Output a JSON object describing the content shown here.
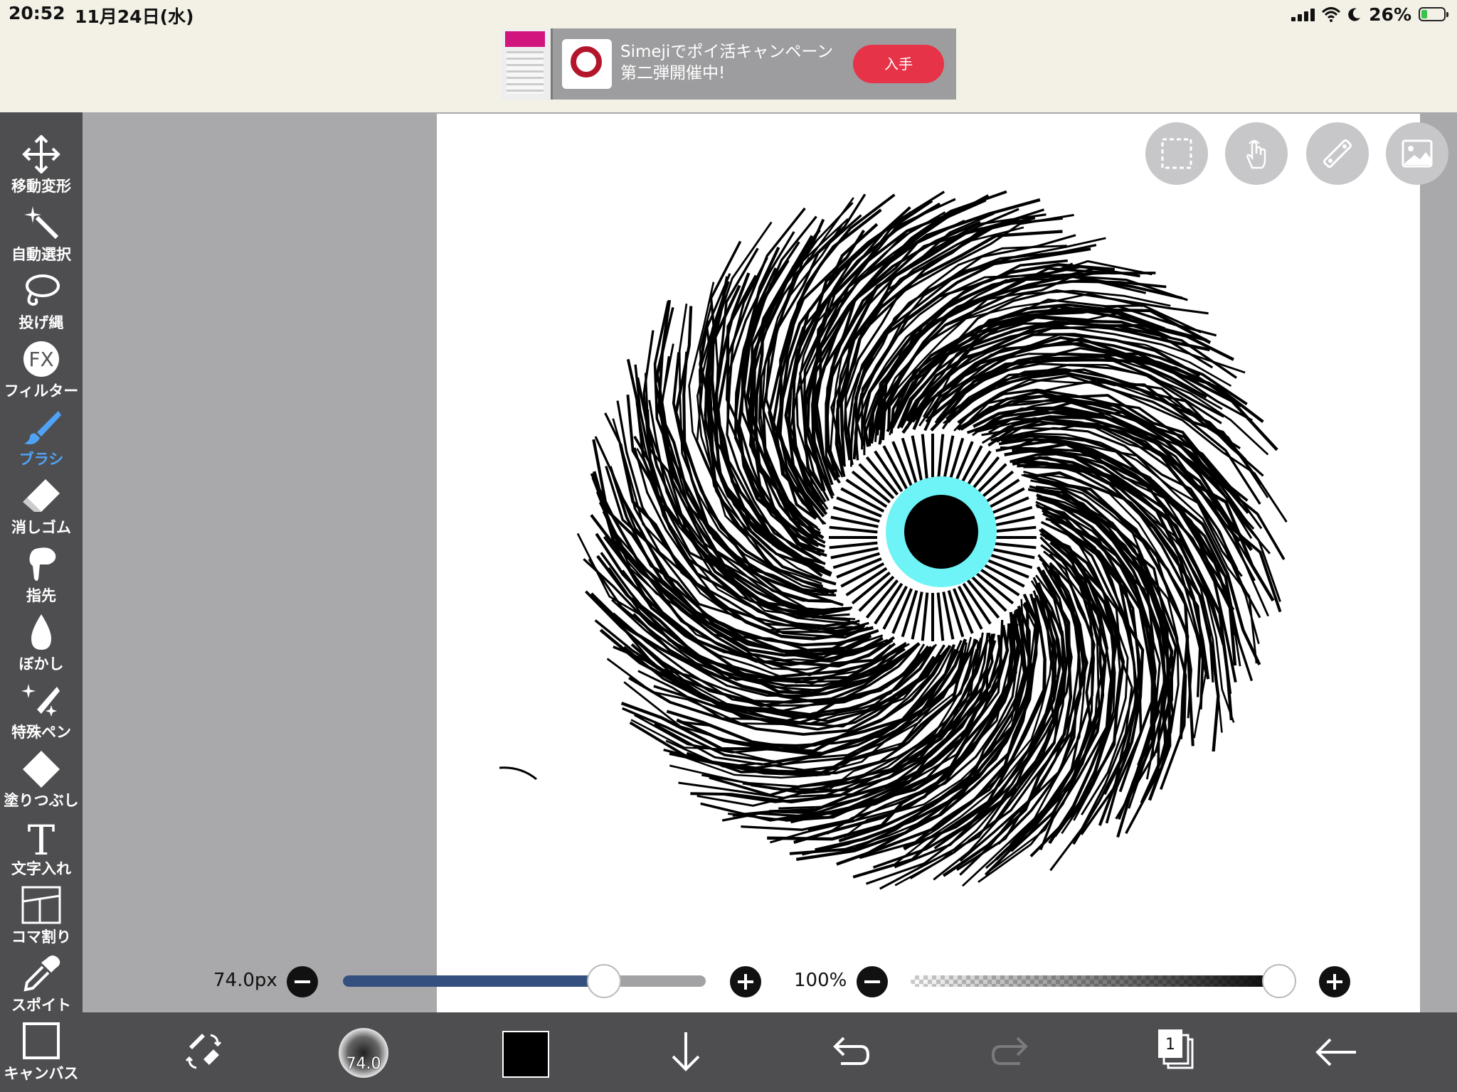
{
  "status_bar": {
    "time": "20:52",
    "date": "11月24日(水)",
    "battery_percent": "26%",
    "battery_level": 0.26
  },
  "ad": {
    "text": "Simejiでポイ活キャンペーン第二弾開催中!",
    "button_label": "入手"
  },
  "tools": [
    {
      "label": "移動変形",
      "icon": "move-transform-icon"
    },
    {
      "label": "自動選択",
      "icon": "magic-wand-icon"
    },
    {
      "label": "投げ縄",
      "icon": "lasso-icon"
    },
    {
      "label": "フィルター",
      "icon": "fx-filter-icon",
      "icon_text": "FX"
    },
    {
      "label": "ブラシ",
      "icon": "brush-icon",
      "active": true
    },
    {
      "label": "消しゴム",
      "icon": "eraser-icon"
    },
    {
      "label": "指先",
      "icon": "finger-smudge-icon"
    },
    {
      "label": "ぼかし",
      "icon": "blur-drop-icon"
    },
    {
      "label": "特殊ペン",
      "icon": "special-pen-icon"
    },
    {
      "label": "塗りつぶし",
      "icon": "fill-bucket-icon"
    },
    {
      "label": "文字入れ",
      "icon": "text-icon",
      "icon_text": "T"
    },
    {
      "label": "コマ割り",
      "icon": "frame-divide-icon"
    },
    {
      "label": "スポイト",
      "icon": "eyedropper-icon"
    },
    {
      "label": "キャンバス",
      "icon": "canvas-icon"
    }
  ],
  "brush": {
    "size_label": "74.0px",
    "size_value": 74.0,
    "size_fraction": 0.72,
    "opacity_label": "100%",
    "opacity_fraction": 1.0,
    "preview_label": "74.0"
  },
  "bottom_bar": {
    "current_color": "#000000",
    "layer_count": "1"
  },
  "colors": {
    "accent": "#4fa3f7",
    "pupil_ring": "#6ef4f6",
    "ad_button": "#e73347",
    "toolbar_bg": "#4e4e50",
    "slider_fill": "#33507e"
  }
}
